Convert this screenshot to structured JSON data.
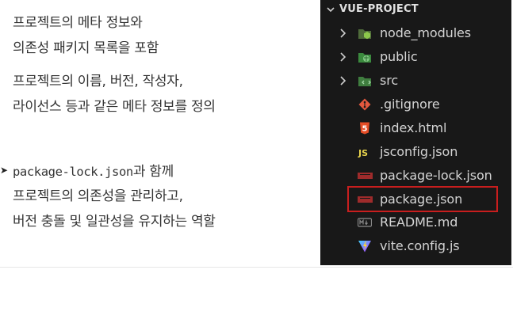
{
  "slide": {
    "lines_group1": [
      "프로젝트의 메타 정보와",
      "의존성 패키지 목록을 포함"
    ],
    "lines_group2": [
      "프로젝트의 이름, 버전, 작성자,",
      "라이선스 등과 같은 메타 정보를 정의"
    ],
    "lock_bullet": {
      "code": "package-lock.json",
      "suffix": "과 함께"
    },
    "lines_group3": [
      "프로젝트의 의존성을 관리하고,",
      "버전 충돌 및 일관성을 유지하는 역할"
    ]
  },
  "explorer": {
    "title": "VUE-PROJECT",
    "items": [
      {
        "label": "node_modules",
        "icon": "folder-node-icon",
        "expandable": true
      },
      {
        "label": "public",
        "icon": "folder-public-icon",
        "expandable": true
      },
      {
        "label": "src",
        "icon": "folder-src-icon",
        "expandable": true
      },
      {
        "label": ".gitignore",
        "icon": "git-icon",
        "expandable": false
      },
      {
        "label": "index.html",
        "icon": "html5-icon",
        "expandable": false
      },
      {
        "label": "jsconfig.json",
        "icon": "js-icon",
        "expandable": false
      },
      {
        "label": "package-lock.json",
        "icon": "npm-icon",
        "expandable": false
      },
      {
        "label": "package.json",
        "icon": "npm-icon",
        "expandable": false
      },
      {
        "label": "README.md",
        "icon": "markdown-icon",
        "expandable": false
      },
      {
        "label": "vite.config.js",
        "icon": "vite-icon",
        "expandable": false
      }
    ],
    "highlighted_item": "package.json"
  },
  "colors": {
    "explorer_bg": "#181818",
    "highlight_border": "#c81e1e",
    "npm_red": "#9e2b2b"
  }
}
